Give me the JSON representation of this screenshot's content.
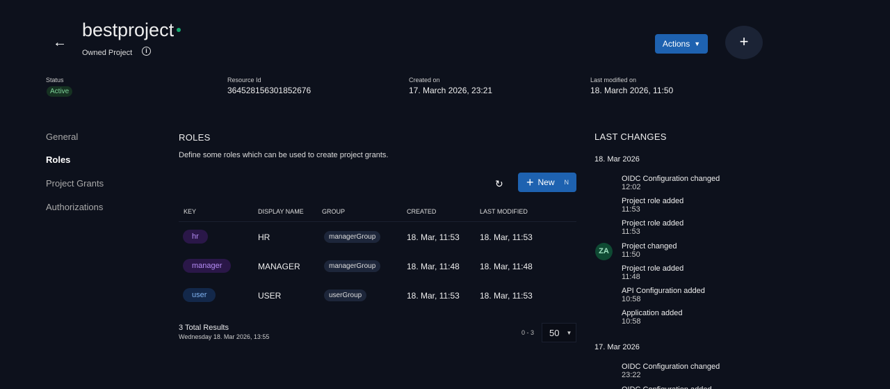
{
  "header": {
    "title": "bestproject",
    "subtitle": "Owned Project",
    "actions_label": "Actions",
    "status_dot_color": "#17a870"
  },
  "meta": {
    "status_label": "Status",
    "status_value": "Active",
    "resource_label": "Resource Id",
    "resource_value": "364528156301852676",
    "created_label": "Created on",
    "created_value": "17. March 2026, 23:21",
    "modified_label": "Last modified on",
    "modified_value": "18. March 2026, 11:50"
  },
  "nav": [
    {
      "label": "General"
    },
    {
      "label": "Roles",
      "active": true
    },
    {
      "label": "Project Grants"
    },
    {
      "label": "Authorizations"
    }
  ],
  "roles": {
    "title": "ROLES",
    "description": "Define some roles which can be used to create project grants.",
    "new_label": "New",
    "new_shortcut": "N",
    "columns": [
      "KEY",
      "DISPLAY NAME",
      "GROUP",
      "CREATED",
      "LAST MODIFIED"
    ],
    "rows": [
      {
        "key": "hr",
        "display": "HR",
        "group": "managerGroup",
        "created": "18. Mar, 11:53",
        "modified": "18. Mar, 11:53",
        "chip_bg": "#2a1748",
        "chip_fg": "#b58cf5"
      },
      {
        "key": "manager",
        "display": "MANAGER",
        "group": "managerGroup",
        "created": "18. Mar, 11:48",
        "modified": "18. Mar, 11:48",
        "chip_bg": "#2a1748",
        "chip_fg": "#b58cf5"
      },
      {
        "key": "user",
        "display": "USER",
        "group": "userGroup",
        "created": "18. Mar, 11:53",
        "modified": "18. Mar, 11:53",
        "chip_bg": "#13284a",
        "chip_fg": "#7fb2f0"
      }
    ],
    "total": "3 Total Results",
    "timestamp": "Wednesday 18. Mar 2026, 13:55",
    "range": "0 - 3",
    "page_size": "50"
  },
  "changes": {
    "title": "LAST CHANGES",
    "avatar": "ZA",
    "groups": [
      {
        "date": "18. Mar 2026",
        "events": [
          {
            "text": "OIDC Configuration changed",
            "time": "12:02"
          },
          {
            "text": "Project role added",
            "time": "11:53"
          },
          {
            "text": "Project role added",
            "time": "11:53"
          },
          {
            "text": "Project changed",
            "time": "11:50"
          },
          {
            "text": "Project role added",
            "time": "11:48"
          },
          {
            "text": "API Configuration added",
            "time": "10:58"
          },
          {
            "text": "Application added",
            "time": "10:58"
          }
        ]
      },
      {
        "date": "17. Mar 2026",
        "events": [
          {
            "text": "OIDC Configuration changed",
            "time": "23:22"
          },
          {
            "text": "OIDC Configuration added",
            "time": ""
          }
        ]
      }
    ]
  }
}
